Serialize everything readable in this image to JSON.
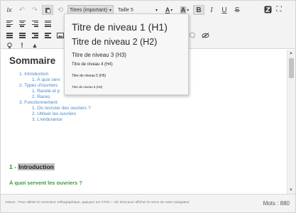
{
  "toolbar": {
    "clear_format": "Ix",
    "headings_select": "Titres (important)",
    "size_select": "Taille 5",
    "bold": "B",
    "italic": "I",
    "underline": "U",
    "strike": "S",
    "text_color": "A",
    "bg_color": "A",
    "alert": "!",
    "warning": "▲"
  },
  "content": {
    "title": "Sommaire",
    "toc": [
      "1. Introduction",
      "1. À quoi serv",
      "2. Types d'ouvriers",
      "1. Rareté et p",
      "2. Races",
      "3. Fonctionnement",
      "1. Où recruter des ouvriers ?",
      "2. Utiliser les ouvriers",
      "3. L'endurance"
    ],
    "section1_num": "1 - ",
    "section1_title": "Introduction",
    "section1_sub": "À quoi servent les ouvriers ?"
  },
  "status": {
    "hint": "Astuce : Pour utiliser le correcteur orthographique, appuyez sur CTRL + clic droit pour afficher le menu de votre navigateur",
    "word_count": "Mots : 880"
  },
  "headings_dropdown": [
    "Titre de niveau 1 (H1)",
    "Titre de niveau 2 (H2)",
    "Titre de niveau 3 (H3)",
    "Titre de niveau 4 (H4)",
    "Titre de niveau 5 (H5)",
    "Titre de niveau 6 (H6)"
  ],
  "icons": {
    "undo": "undo-icon",
    "redo": "redo-icon",
    "paste": "paste-icon",
    "history": "history-icon",
    "logo": "app-logo-icon",
    "fullscreen": "fullscreen-icon"
  }
}
